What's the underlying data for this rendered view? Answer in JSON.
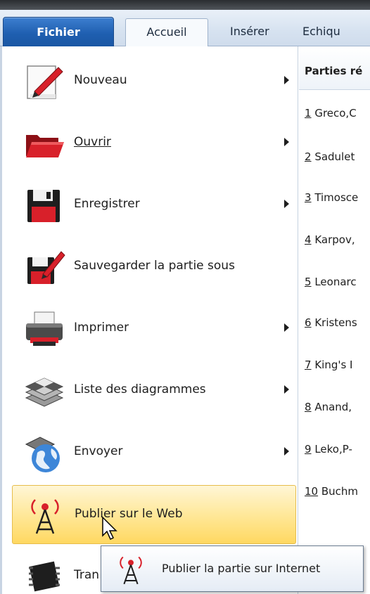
{
  "tabs": {
    "fichier": "Fichier",
    "accueil": "Accueil",
    "inserer": "Insérer",
    "echiquier": "Echiqu"
  },
  "menu": {
    "items": [
      {
        "label": "Nouveau",
        "has_submenu": true
      },
      {
        "label": "Ouvrir",
        "has_submenu": true
      },
      {
        "label": "Enregistrer",
        "has_submenu": true
      },
      {
        "label": "Sauvegarder la partie sous",
        "has_submenu": false
      },
      {
        "label": "Imprimer",
        "has_submenu": true
      },
      {
        "label": "Liste des diagrammes",
        "has_submenu": true
      },
      {
        "label": "Envoyer",
        "has_submenu": true
      },
      {
        "label": "Publier sur le Web",
        "has_submenu": false
      },
      {
        "label": "Tran",
        "has_submenu": false
      }
    ],
    "highlighted_item": "Publier sur le Web"
  },
  "pane": {
    "header": "Parties ré",
    "games": [
      {
        "num": "1",
        "text": " Greco,C"
      },
      {
        "num": "2",
        "text": " Sadulet"
      },
      {
        "num": "3",
        "text": " Timosce"
      },
      {
        "num": "4",
        "text": " Karpov,"
      },
      {
        "num": "5",
        "text": " Leonarc"
      },
      {
        "num": "6",
        "text": " Kristens"
      },
      {
        "num": "7",
        "text": " King's I"
      },
      {
        "num": "8",
        "text": " Anand,"
      },
      {
        "num": "9",
        "text": " Leko,P-"
      },
      {
        "num": "10",
        "text": " Buchm"
      }
    ]
  },
  "tooltip": {
    "text": "Publier la partie sur Internet"
  },
  "colors": {
    "fichier_tab": "#1f5fb0",
    "highlight": "#ffe89a",
    "red_accent": "#d8202a"
  }
}
